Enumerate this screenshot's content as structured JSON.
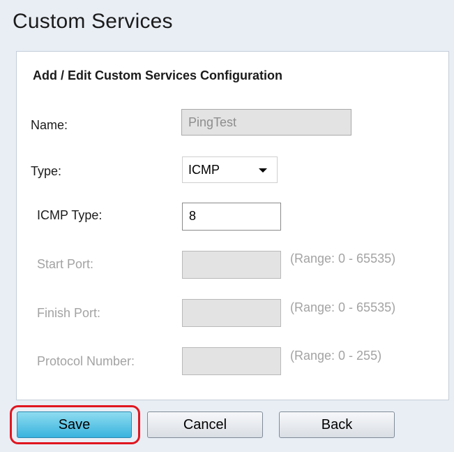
{
  "page": {
    "title": "Custom Services"
  },
  "panel": {
    "heading": "Add / Edit Custom Services Configuration"
  },
  "form": {
    "name": {
      "label": "Name:",
      "value": "PingTest"
    },
    "type": {
      "label": "Type:",
      "selected": "ICMP"
    },
    "icmp_type": {
      "label": "ICMP Type:",
      "value": "8"
    },
    "start_port": {
      "label": "Start Port:",
      "value": "",
      "range": "(Range: 0 - 65535)"
    },
    "finish_port": {
      "label": "Finish Port:",
      "value": "",
      "range": "(Range: 0 - 65535)"
    },
    "protocol_number": {
      "label": "Protocol Number:",
      "value": "",
      "range": "(Range: 0 - 255)"
    }
  },
  "buttons": {
    "save": "Save",
    "cancel": "Cancel",
    "back": "Back"
  },
  "colors": {
    "highlight": "#e0161f",
    "primary_button": "#38b3de",
    "background": "#e9eef5"
  }
}
